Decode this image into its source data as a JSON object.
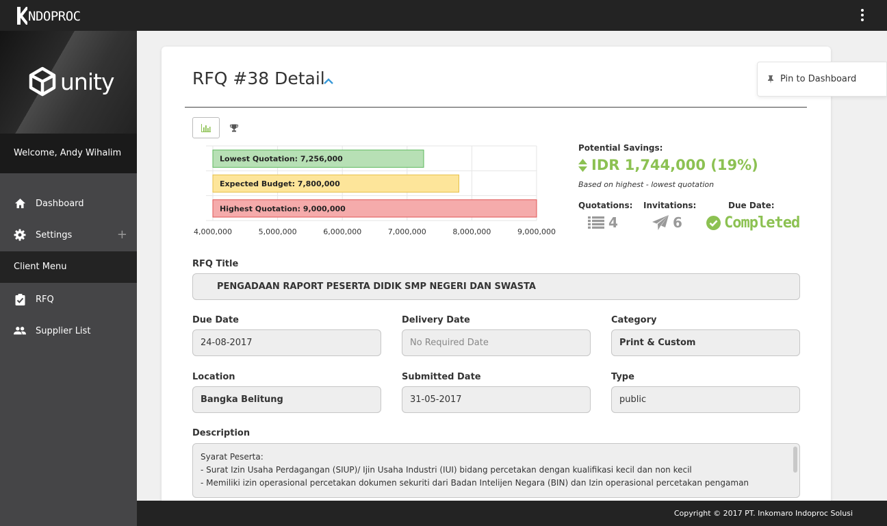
{
  "app": {
    "logo_text": "NDOPROC"
  },
  "sidebar": {
    "brand_text": "unity",
    "welcome": "Welcome, Andy Wihalim",
    "items": [
      {
        "label": "Dashboard",
        "icon": "home-icon"
      },
      {
        "label": "Settings",
        "icon": "gear-icon"
      },
      {
        "label": "RFQ",
        "icon": "clipboard-check-icon"
      },
      {
        "label": "Supplier List",
        "icon": "users-icon"
      }
    ],
    "section_label": "Client Menu",
    "expand_symbol": "+"
  },
  "header": {
    "title": "RFQ #38 Detail"
  },
  "pin": {
    "label": "Pin to Dashboard"
  },
  "chart_data": {
    "type": "bar",
    "orientation": "horizontal",
    "categories": [
      "Lowest Quotation",
      "Expected Budget",
      "Highest Quotation"
    ],
    "bar_labels": [
      "Lowest Quotation: 7,256,000",
      "Expected Budget: 7,800,000",
      "Highest Quotation: 9,000,000"
    ],
    "values": [
      7256000,
      7800000,
      9000000
    ],
    "colors": [
      "#b7e0b5",
      "#fde59a",
      "#f5abab"
    ],
    "borders": [
      "#5cb85c",
      "#e6c04a",
      "#e05555"
    ],
    "xlim": [
      4000000,
      9000000
    ],
    "xticks": [
      4000000,
      5000000,
      6000000,
      7000000,
      8000000,
      9000000
    ],
    "xtick_labels": [
      "4,000,000",
      "5,000,000",
      "6,000,000",
      "7,000,000",
      "8,000,000",
      "9,000,000"
    ],
    "grid": true
  },
  "stats": {
    "savings_label": "Potential Savings:",
    "savings_value": "IDR 1,744,000 (19%)",
    "savings_note": "Based on highest - lowest quotation",
    "quotations_label": "Quotations:",
    "quotations_value": "4",
    "invitations_label": "Invitations:",
    "invitations_value": "6",
    "due_label": "Due Date:",
    "due_value": "Completed"
  },
  "form": {
    "rfq_title_label": "RFQ Title",
    "rfq_title_value": "PENGADAAN RAPORT PESERTA DIDIK SMP NEGERI DAN SWASTA",
    "due_date_label": "Due Date",
    "due_date_value": "24-08-2017",
    "delivery_date_label": "Delivery Date",
    "delivery_date_value": "No Required Date",
    "category_label": "Category",
    "category_value": "Print & Custom",
    "location_label": "Location",
    "location_value": "Bangka Belitung",
    "submitted_label": "Submitted Date",
    "submitted_value": "31-05-2017",
    "type_label": "Type",
    "type_value": "public",
    "description_label": "Description",
    "description_lines": [
      "Syarat Peserta:",
      "- Surat Izin Usaha Perdagangan (SIUP)/ Ijin Usaha Industri (IUI) bidang percetakan dengan kualifikasi kecil dan non kecil",
      "- Memiliki izin operasional percetakan dokumen sekuriti dari Badan Intelijen Negara (BIN) dan Izin operasional percetakan pengaman"
    ]
  },
  "footer": {
    "copyright": "Copyright © 2017 PT. Inkomaro Indoproc Solusi"
  },
  "colors": {
    "accent_green": "#8cc152",
    "topbar": "#232323",
    "sidebar": "#454547",
    "link_blue": "#3a9ad9"
  }
}
